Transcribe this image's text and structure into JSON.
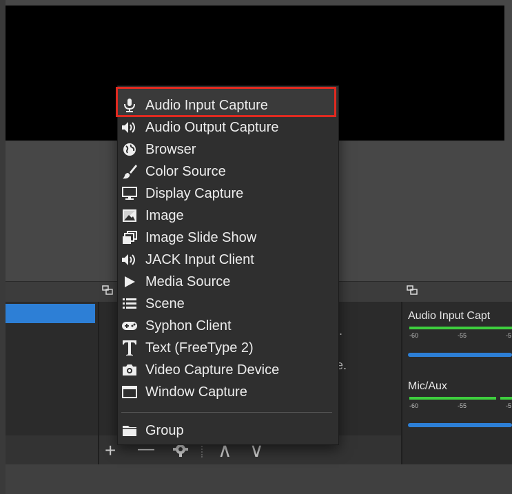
{
  "preview": {},
  "dock": {
    "mixer_icon": "dock-float-icon"
  },
  "sources_hidden_text": [
    ".",
    "e."
  ],
  "mixer": {
    "channels": [
      {
        "name": "Audio Input Capt",
        "ticks": [
          "-60",
          "-55",
          "-5"
        ]
      },
      {
        "name": "Mic/Aux",
        "ticks": [
          "-60",
          "-55",
          "-5"
        ]
      }
    ]
  },
  "toolbar": {
    "add": "+",
    "remove": "—",
    "up": "∧",
    "down": "∨"
  },
  "menu": {
    "items": [
      {
        "label": "Audio Input Capture",
        "icon": "microphone-icon"
      },
      {
        "label": "Audio Output Capture",
        "icon": "speaker-icon"
      },
      {
        "label": "Browser",
        "icon": "globe-icon"
      },
      {
        "label": "Color Source",
        "icon": "brush-icon"
      },
      {
        "label": "Display Capture",
        "icon": "monitor-icon"
      },
      {
        "label": "Image",
        "icon": "image-icon"
      },
      {
        "label": "Image Slide Show",
        "icon": "slideshow-icon"
      },
      {
        "label": "JACK Input Client",
        "icon": "speaker-icon"
      },
      {
        "label": "Media Source",
        "icon": "play-icon"
      },
      {
        "label": "Scene",
        "icon": "list-icon"
      },
      {
        "label": "Syphon Client",
        "icon": "gamepad-icon"
      },
      {
        "label": "Text (FreeType 2)",
        "icon": "text-icon"
      },
      {
        "label": "Video Capture Device",
        "icon": "camera-icon"
      },
      {
        "label": "Window Capture",
        "icon": "window-icon"
      },
      {
        "label": "Group",
        "icon": "folder-icon"
      }
    ]
  },
  "colors": {
    "highlight_border": "#e02a20",
    "selection_blue": "#2d7fd6",
    "meter_green": "#3ecf3e"
  }
}
